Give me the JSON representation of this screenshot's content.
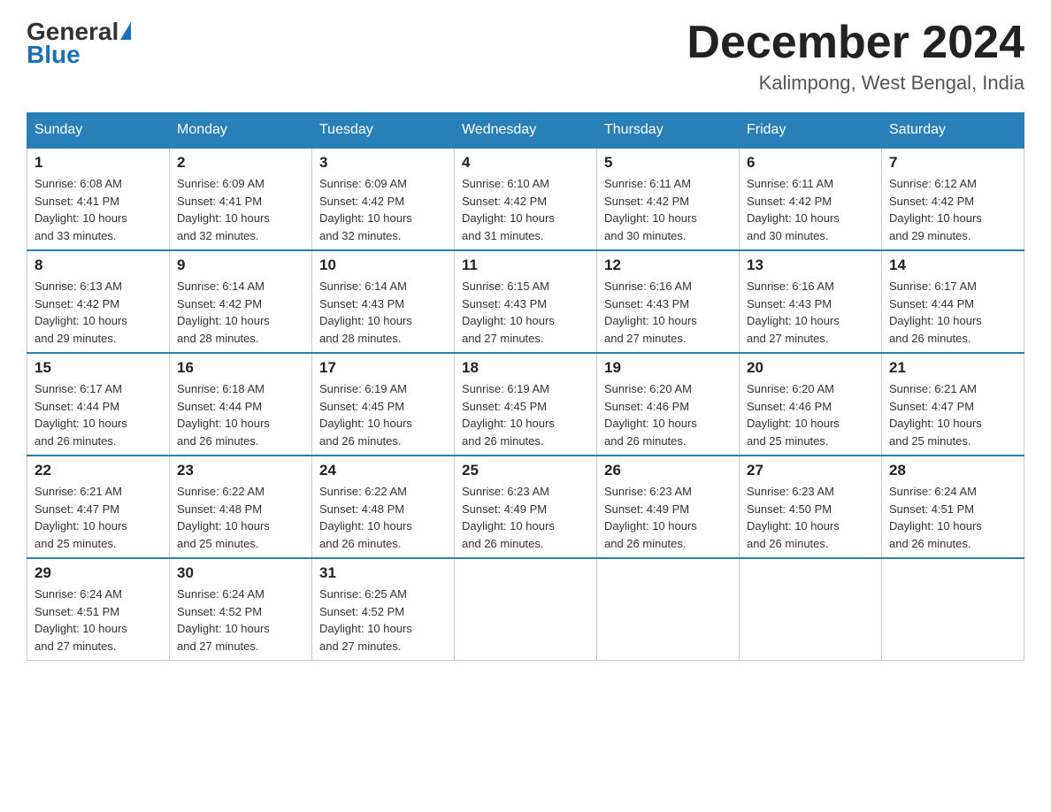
{
  "header": {
    "logo_general": "General",
    "logo_blue": "Blue",
    "month_title": "December 2024",
    "location": "Kalimpong, West Bengal, India"
  },
  "columns": [
    "Sunday",
    "Monday",
    "Tuesday",
    "Wednesday",
    "Thursday",
    "Friday",
    "Saturday"
  ],
  "weeks": [
    [
      {
        "day": "1",
        "sunrise": "6:08 AM",
        "sunset": "4:41 PM",
        "daylight": "10 hours and 33 minutes."
      },
      {
        "day": "2",
        "sunrise": "6:09 AM",
        "sunset": "4:41 PM",
        "daylight": "10 hours and 32 minutes."
      },
      {
        "day": "3",
        "sunrise": "6:09 AM",
        "sunset": "4:42 PM",
        "daylight": "10 hours and 32 minutes."
      },
      {
        "day": "4",
        "sunrise": "6:10 AM",
        "sunset": "4:42 PM",
        "daylight": "10 hours and 31 minutes."
      },
      {
        "day": "5",
        "sunrise": "6:11 AM",
        "sunset": "4:42 PM",
        "daylight": "10 hours and 30 minutes."
      },
      {
        "day": "6",
        "sunrise": "6:11 AM",
        "sunset": "4:42 PM",
        "daylight": "10 hours and 30 minutes."
      },
      {
        "day": "7",
        "sunrise": "6:12 AM",
        "sunset": "4:42 PM",
        "daylight": "10 hours and 29 minutes."
      }
    ],
    [
      {
        "day": "8",
        "sunrise": "6:13 AM",
        "sunset": "4:42 PM",
        "daylight": "10 hours and 29 minutes."
      },
      {
        "day": "9",
        "sunrise": "6:14 AM",
        "sunset": "4:42 PM",
        "daylight": "10 hours and 28 minutes."
      },
      {
        "day": "10",
        "sunrise": "6:14 AM",
        "sunset": "4:43 PM",
        "daylight": "10 hours and 28 minutes."
      },
      {
        "day": "11",
        "sunrise": "6:15 AM",
        "sunset": "4:43 PM",
        "daylight": "10 hours and 27 minutes."
      },
      {
        "day": "12",
        "sunrise": "6:16 AM",
        "sunset": "4:43 PM",
        "daylight": "10 hours and 27 minutes."
      },
      {
        "day": "13",
        "sunrise": "6:16 AM",
        "sunset": "4:43 PM",
        "daylight": "10 hours and 27 minutes."
      },
      {
        "day": "14",
        "sunrise": "6:17 AM",
        "sunset": "4:44 PM",
        "daylight": "10 hours and 26 minutes."
      }
    ],
    [
      {
        "day": "15",
        "sunrise": "6:17 AM",
        "sunset": "4:44 PM",
        "daylight": "10 hours and 26 minutes."
      },
      {
        "day": "16",
        "sunrise": "6:18 AM",
        "sunset": "4:44 PM",
        "daylight": "10 hours and 26 minutes."
      },
      {
        "day": "17",
        "sunrise": "6:19 AM",
        "sunset": "4:45 PM",
        "daylight": "10 hours and 26 minutes."
      },
      {
        "day": "18",
        "sunrise": "6:19 AM",
        "sunset": "4:45 PM",
        "daylight": "10 hours and 26 minutes."
      },
      {
        "day": "19",
        "sunrise": "6:20 AM",
        "sunset": "4:46 PM",
        "daylight": "10 hours and 26 minutes."
      },
      {
        "day": "20",
        "sunrise": "6:20 AM",
        "sunset": "4:46 PM",
        "daylight": "10 hours and 25 minutes."
      },
      {
        "day": "21",
        "sunrise": "6:21 AM",
        "sunset": "4:47 PM",
        "daylight": "10 hours and 25 minutes."
      }
    ],
    [
      {
        "day": "22",
        "sunrise": "6:21 AM",
        "sunset": "4:47 PM",
        "daylight": "10 hours and 25 minutes."
      },
      {
        "day": "23",
        "sunrise": "6:22 AM",
        "sunset": "4:48 PM",
        "daylight": "10 hours and 25 minutes."
      },
      {
        "day": "24",
        "sunrise": "6:22 AM",
        "sunset": "4:48 PM",
        "daylight": "10 hours and 26 minutes."
      },
      {
        "day": "25",
        "sunrise": "6:23 AM",
        "sunset": "4:49 PM",
        "daylight": "10 hours and 26 minutes."
      },
      {
        "day": "26",
        "sunrise": "6:23 AM",
        "sunset": "4:49 PM",
        "daylight": "10 hours and 26 minutes."
      },
      {
        "day": "27",
        "sunrise": "6:23 AM",
        "sunset": "4:50 PM",
        "daylight": "10 hours and 26 minutes."
      },
      {
        "day": "28",
        "sunrise": "6:24 AM",
        "sunset": "4:51 PM",
        "daylight": "10 hours and 26 minutes."
      }
    ],
    [
      {
        "day": "29",
        "sunrise": "6:24 AM",
        "sunset": "4:51 PM",
        "daylight": "10 hours and 27 minutes."
      },
      {
        "day": "30",
        "sunrise": "6:24 AM",
        "sunset": "4:52 PM",
        "daylight": "10 hours and 27 minutes."
      },
      {
        "day": "31",
        "sunrise": "6:25 AM",
        "sunset": "4:52 PM",
        "daylight": "10 hours and 27 minutes."
      },
      null,
      null,
      null,
      null
    ]
  ],
  "labels": {
    "sunrise": "Sunrise:",
    "sunset": "Sunset:",
    "daylight": "Daylight:"
  }
}
